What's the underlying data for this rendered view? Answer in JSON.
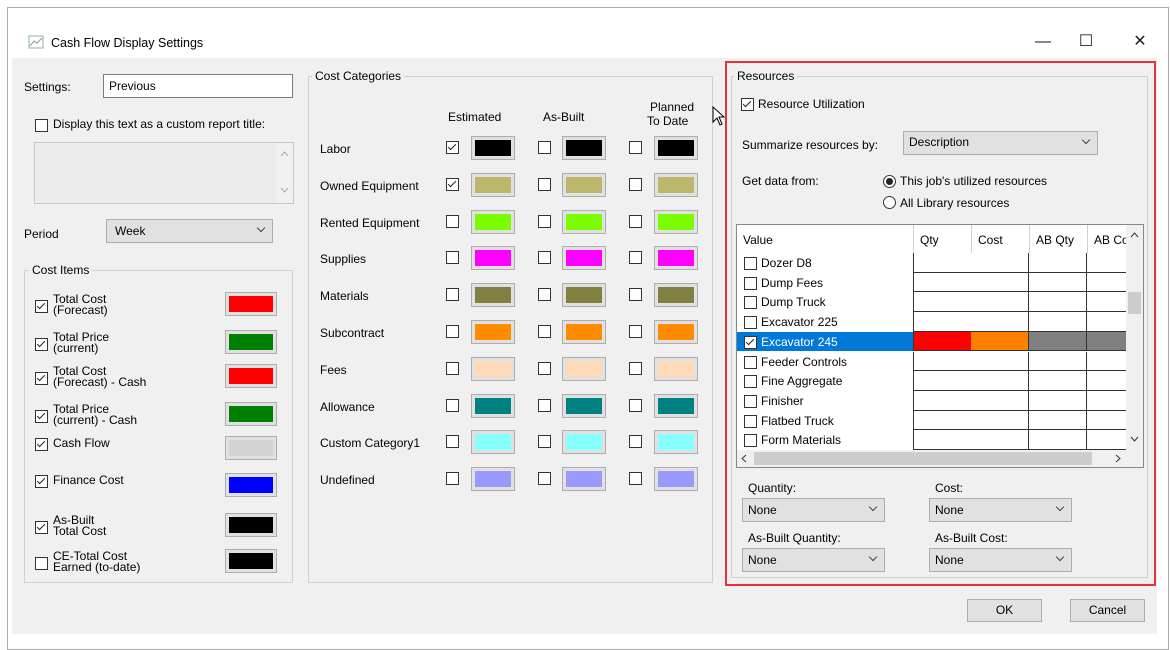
{
  "window": {
    "title": "Cash Flow Display Settings",
    "min_glyph": "—",
    "max_glyph": "☐",
    "close_glyph": "✕"
  },
  "settings": {
    "label": "Settings:",
    "value": "Previous",
    "custom_title_label": "Display this text as a custom report title:",
    "custom_title_checked": false,
    "period_label": "Period",
    "period_value": "Week"
  },
  "cost_items": {
    "legend": "Cost Items",
    "items": [
      {
        "line1": "Total Cost",
        "line2": "(Forecast)",
        "checked": true,
        "color": "#ff0000"
      },
      {
        "line1": "Total Price",
        "line2": "(current)",
        "checked": true,
        "color": "#008000"
      },
      {
        "line1": "Total Cost",
        "line2": "(Forecast) - Cash",
        "checked": true,
        "color": "#ff0000"
      },
      {
        "line1": "Total Price",
        "line2": "(current) - Cash",
        "checked": true,
        "color": "#008000"
      },
      {
        "line1": "Cash Flow",
        "line2": "",
        "checked": true,
        "color": "#d3d3d3"
      },
      {
        "line1": "Finance Cost",
        "line2": "",
        "checked": true,
        "color": "#0000ff"
      },
      {
        "line1": "As-Built",
        "line2": "Total Cost",
        "checked": true,
        "color": "#000000"
      },
      {
        "line1": "CE-Total Cost",
        "line2": "Earned (to-date)",
        "checked": false,
        "color": "#000000"
      }
    ]
  },
  "cost_categories": {
    "legend": "Cost Categories",
    "col_estimated": "Estimated",
    "col_asbuilt": "As-Built",
    "col_planned_1": "Planned",
    "col_planned_2": "To Date",
    "rows": [
      {
        "name": "Labor",
        "estimated": true,
        "asbuilt": false,
        "planned": false,
        "color": "#000000"
      },
      {
        "name": "Owned Equipment",
        "estimated": true,
        "asbuilt": false,
        "planned": false,
        "color": "#bdb76b"
      },
      {
        "name": "Rented Equipment",
        "estimated": false,
        "asbuilt": false,
        "planned": false,
        "color": "#7cfc00"
      },
      {
        "name": "Supplies",
        "estimated": false,
        "asbuilt": false,
        "planned": false,
        "color": "#ff00ff"
      },
      {
        "name": "Materials",
        "estimated": false,
        "asbuilt": false,
        "planned": false,
        "color": "#808040"
      },
      {
        "name": "Subcontract",
        "estimated": false,
        "asbuilt": false,
        "planned": false,
        "color": "#ff8c00"
      },
      {
        "name": "Fees",
        "estimated": false,
        "asbuilt": false,
        "planned": false,
        "color": "#ffdab9"
      },
      {
        "name": "Allowance",
        "estimated": false,
        "asbuilt": false,
        "planned": false,
        "color": "#008080"
      },
      {
        "name": "Custom Category1",
        "estimated": false,
        "asbuilt": false,
        "planned": false,
        "color": "#87ffff"
      },
      {
        "name": "Undefined",
        "estimated": false,
        "asbuilt": false,
        "planned": false,
        "color": "#9999ff"
      }
    ]
  },
  "resources": {
    "legend": "Resources",
    "utilization_label": "Resource Utilization",
    "utilization_checked": true,
    "summarize_label": "Summarize resources by:",
    "summarize_value": "Description",
    "getdata_label": "Get data from:",
    "radio_job": "This job's utilized resources",
    "radio_library": "All Library resources",
    "radio_selected": "job",
    "grid_headers": [
      "Value",
      "Qty",
      "Cost",
      "AB Qty",
      "AB Co"
    ],
    "grid_rows": [
      {
        "name": "Dozer D8",
        "checked": false,
        "selected": false
      },
      {
        "name": "Dump Fees",
        "checked": false,
        "selected": false
      },
      {
        "name": "Dump Truck",
        "checked": false,
        "selected": false
      },
      {
        "name": "Excavator 225",
        "checked": false,
        "selected": false
      },
      {
        "name": "Excavator 245",
        "checked": true,
        "selected": true
      },
      {
        "name": "Feeder Controls",
        "checked": false,
        "selected": false
      },
      {
        "name": "Fine Aggregate",
        "checked": false,
        "selected": false
      },
      {
        "name": "Finisher",
        "checked": false,
        "selected": false
      },
      {
        "name": "Flatbed Truck",
        "checked": false,
        "selected": false
      },
      {
        "name": "Form Materials",
        "checked": false,
        "selected": false
      }
    ],
    "selected_colors": [
      "#ff0000",
      "#ff8000",
      "#808080",
      "#808080"
    ],
    "quantity_label": "Quantity:",
    "quantity_value": "None",
    "cost_label": "Cost:",
    "cost_value": "None",
    "ab_quantity_label": "As-Built Quantity:",
    "ab_quantity_value": "None",
    "ab_cost_label": "As-Built Cost:",
    "ab_cost_value": "None"
  },
  "buttons": {
    "ok": "OK",
    "cancel": "Cancel"
  },
  "colors": {
    "highlight_border": "#e5323c",
    "selection": "#0078d7"
  }
}
